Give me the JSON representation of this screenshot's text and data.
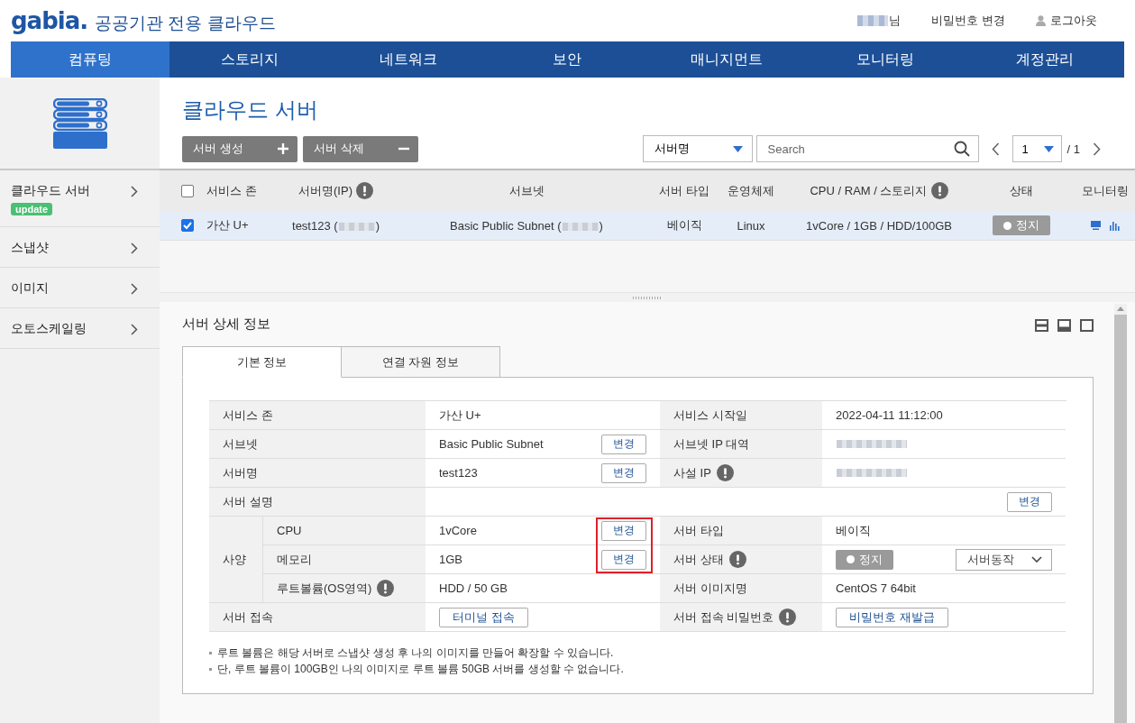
{
  "header": {
    "logo": "gabia.",
    "subtitle": "공공기관 전용 클라우드",
    "user_redacted": true,
    "user_suffix": "님",
    "links": [
      {
        "label": "비밀번호 변경",
        "kind": "plain"
      },
      {
        "label": "로그아웃",
        "kind": "user"
      }
    ]
  },
  "nav": [
    {
      "label": "컴퓨팅",
      "selected": true
    },
    {
      "label": "스토리지",
      "selected": false
    },
    {
      "label": "네트워크",
      "selected": false
    },
    {
      "label": "보안",
      "selected": false
    },
    {
      "label": "매니지먼트",
      "selected": false
    },
    {
      "label": "모니터링",
      "selected": false
    },
    {
      "label": "계정관리",
      "selected": false
    }
  ],
  "sidebar": {
    "items": [
      {
        "label": "클라우드 서버",
        "badge": "update"
      },
      {
        "label": "스냅샷"
      },
      {
        "label": "이미지"
      },
      {
        "label": "오토스케일링"
      }
    ]
  },
  "page": {
    "title": "클라우드 서버",
    "actions": [
      {
        "label": "서버 생성",
        "kind": "plus"
      },
      {
        "label": "서버 삭제",
        "kind": "minus"
      }
    ],
    "filter": "서버명",
    "search_placeholder": "Search",
    "page": "1",
    "total": "/ 1"
  },
  "table": {
    "all_checked": false,
    "columns": [
      {
        "label": "서비스 존"
      },
      {
        "label": "서버명(IP)",
        "info": true
      },
      {
        "label": "서브넷"
      },
      {
        "label": "서버 타입"
      },
      {
        "label": "운영체제"
      },
      {
        "label": "CPU / RAM / 스토리지",
        "info": true
      },
      {
        "label": "상태"
      },
      {
        "label": "모니터링"
      }
    ],
    "rows": [
      {
        "checked": true,
        "zone": "가산 U+",
        "name": "test123 (",
        "name_end": ")",
        "subnet": "Basic Public Subnet (",
        "subnet_end": ")",
        "type": "베이직",
        "os": "Linux",
        "spec": "1vCore / 1GB / HDD/100GB",
        "status": "정지",
        "running": false
      }
    ]
  },
  "detail": {
    "title": "서버 상세 정보",
    "tabs": [
      {
        "label": "기본 정보",
        "selected": true
      },
      {
        "label": "연결 자원 정보",
        "selected": false
      }
    ],
    "rows": [
      {
        "kind": "pair",
        "left": {
          "label": "서비스 존",
          "value": "가산 U+"
        },
        "right": {
          "label": "서비스 시작일",
          "value": "2022-04-11 11:12:00"
        }
      },
      {
        "kind": "pair",
        "left": {
          "label": "서브넷",
          "value": "Basic Public Subnet",
          "change": "변경"
        },
        "right": {
          "label": "서브넷 IP 대역",
          "redacted": true
        }
      },
      {
        "kind": "pair",
        "left": {
          "label": "서버명",
          "value": "test123",
          "change": "변경"
        },
        "right": {
          "label": "사설 IP",
          "info": true,
          "redacted": true
        }
      },
      {
        "kind": "wide",
        "label": "서버 설명",
        "change": "변경"
      },
      {
        "kind": "group",
        "label": "사양",
        "rows": [
          {
            "highlighted": true,
            "left": {
              "label": "CPU",
              "value": "1vCore",
              "change": "변경"
            },
            "right": {
              "label": "서버 타입",
              "value": "베이직"
            }
          },
          {
            "highlighted": true,
            "left": {
              "label": "메모리",
              "value": "1GB",
              "change": "변경"
            },
            "right": {
              "label": "서버 상태",
              "info": true,
              "status": "정지",
              "running": false,
              "action": "서버동작"
            }
          },
          {
            "left": {
              "label": "루트볼륨(OS영역)",
              "info": true,
              "value": "HDD / 50 GB"
            },
            "right": {
              "label": "서버 이미지명",
              "value": "CentOS 7 64bit"
            }
          }
        ]
      },
      {
        "kind": "pair",
        "left": {
          "label": "서버 접속",
          "button": "터미널 접속"
        },
        "right": {
          "label": "서버 접속 비밀번호",
          "info": true,
          "button": "비밀번호 재발급"
        }
      }
    ],
    "notes": [
      "루트 볼륨은 해당 서버로 스냅샷 생성 후 나의 이미지를 만들어 확장할 수 있습니다.",
      "단, 루트 볼륨이 100GB인 나의 이미지로 루트 볼륨 50GB 서버를 생성할 수 없습니다."
    ]
  }
}
